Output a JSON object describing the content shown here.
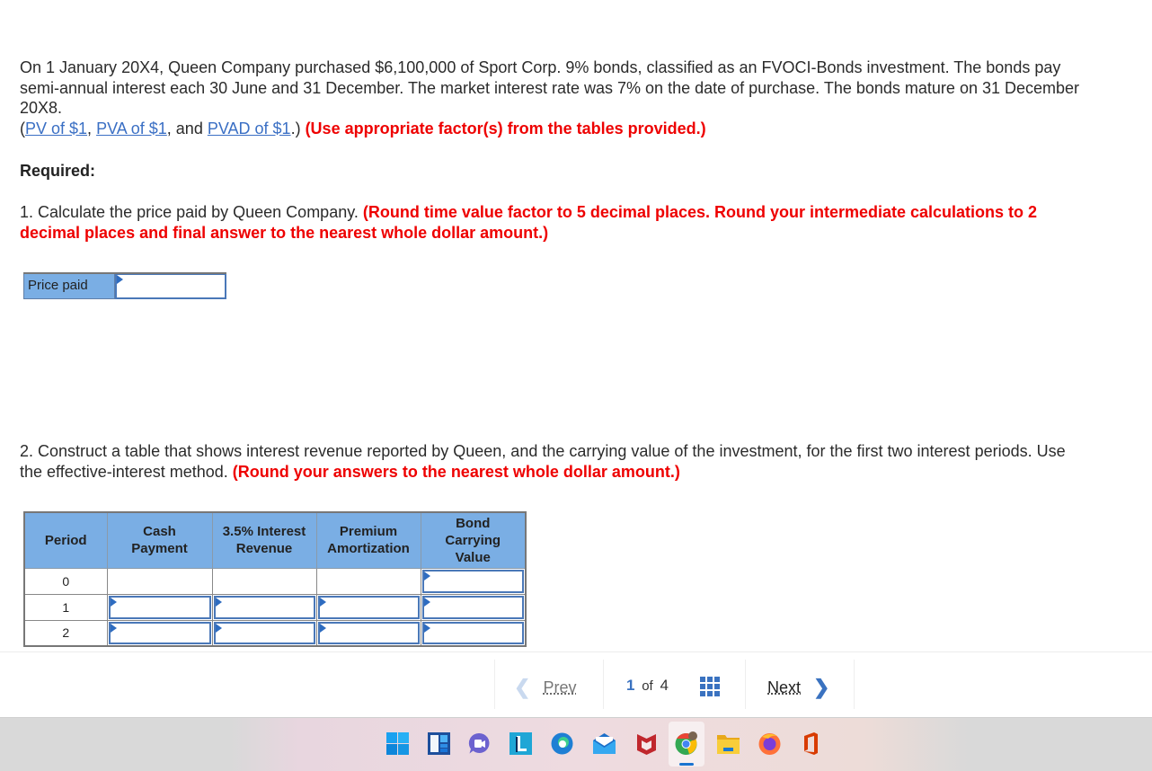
{
  "problem": {
    "intro": "On 1 January 20X4, Queen Company purchased $6,100,000 of Sport Corp. 9% bonds, classified as an FVOCI-Bonds investment. The bonds pay semi-annual interest each 30 June and 31 December. The market interest rate was 7% on the date of purchase. The bonds mature on 31 December 20X8.",
    "refs": {
      "open_paren": "(",
      "link1": "PV of $1",
      "sep1": ", ",
      "link2": "PVA of $1",
      "sep2": ", and ",
      "link3": "PVAD of $1",
      "close": ".) ",
      "instruction": "(Use appropriate factor(s) from the tables provided.)"
    },
    "required_label": "Required:",
    "q1": {
      "text": "1. Calculate the price paid by Queen Company. ",
      "instruction": "(Round time value factor to 5 decimal places. Round your intermediate calculations to 2 decimal places and final answer to the nearest whole dollar amount.)"
    },
    "price_paid": {
      "label": "Price paid",
      "value": ""
    },
    "q2": {
      "text": "2. Construct a table that shows interest revenue reported by Queen, and the carrying value of the investment, for the first two interest periods. Use the effective-interest method. ",
      "instruction": "(Round your answers to the nearest whole dollar amount.)"
    }
  },
  "table": {
    "headers": [
      "Period",
      "Cash Payment",
      "3.5% Interest Revenue",
      "Premium Amortization",
      "Bond Carrying Value"
    ],
    "rows": [
      {
        "period": "0",
        "cash_payment": null,
        "interest_revenue": null,
        "premium_amortization": null,
        "carrying_value": ""
      },
      {
        "period": "1",
        "cash_payment": "",
        "interest_revenue": "",
        "premium_amortization": "",
        "carrying_value": ""
      },
      {
        "period": "2",
        "cash_payment": "",
        "interest_revenue": "",
        "premium_amortization": "",
        "carrying_value": ""
      }
    ]
  },
  "pager": {
    "prev_label": "Prev",
    "current_page": "1",
    "of_label": "of",
    "total_pages": "4",
    "next_label": "Next"
  },
  "taskbar": {
    "icons": [
      "windows-start-icon",
      "widgets-icon",
      "teams-chat-icon",
      "l-app-icon",
      "edge-icon",
      "mail-icon",
      "mcafee-icon",
      "chrome-icon",
      "file-explorer-icon",
      "firefox-icon",
      "office-icon"
    ],
    "active": "chrome-icon"
  },
  "colors": {
    "accent_blue": "#3a72c0",
    "header_blue": "#7aaee4",
    "instruction_red": "#ee0000",
    "link_blue": "#3a6fc4"
  }
}
